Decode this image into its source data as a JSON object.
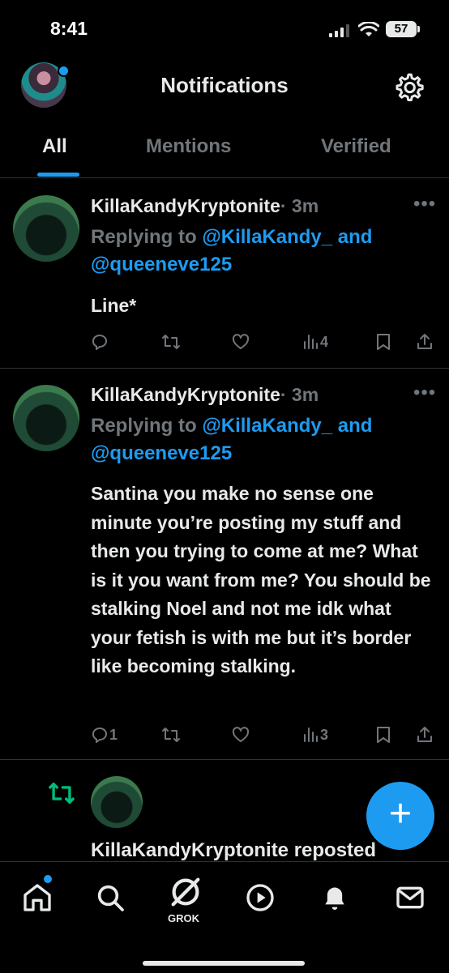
{
  "status_bar": {
    "time": "8:41",
    "battery": "57"
  },
  "header": {
    "title": "Notifications"
  },
  "tabs": [
    {
      "label": "All",
      "active": true
    },
    {
      "label": "Mentions",
      "active": false
    },
    {
      "label": "Verified",
      "active": false
    }
  ],
  "posts": [
    {
      "author": "KillaKandyKryptonite",
      "time": "· 3m",
      "reply_prefix": "Replying to ",
      "reply_handle1": "@KillaKandy_",
      "reply_and": " and",
      "reply_handle2": "@queeneve125",
      "text": "Line*",
      "counts": {
        "replies": "",
        "reposts": "",
        "likes": "",
        "views": "4"
      }
    },
    {
      "author": "KillaKandyKryptonite",
      "time": "· 3m",
      "reply_prefix": "Replying to ",
      "reply_handle1": "@KillaKandy_",
      "reply_and": " and",
      "reply_handle2": "@queeneve125",
      "text": "Santina you make no sense one minute you’re posting my stuff and then you trying to come at me? What is it you want from me? You should be stalking Noel and not me idk what your fetish is with me but it’s border like becoming stalking.",
      "counts": {
        "replies": "1",
        "reposts": "",
        "likes": "",
        "views": "3"
      }
    }
  ],
  "repost_notification": {
    "text": "KillaKandyKryptonite reposted"
  },
  "bottom_nav": {
    "grok_label": "GROK"
  },
  "colors": {
    "accent": "#1d9bf0",
    "muted": "#71767b",
    "repost_green": "#00ba7c",
    "bg": "#000000"
  },
  "icons": [
    "signal-icon",
    "wifi-icon",
    "battery-icon",
    "gear-icon",
    "reply-icon",
    "repost-icon",
    "like-icon",
    "views-icon",
    "bookmark-icon",
    "share-icon",
    "plus-icon",
    "home-icon",
    "search-icon",
    "grok-icon",
    "play-icon",
    "bell-icon",
    "mail-icon"
  ]
}
